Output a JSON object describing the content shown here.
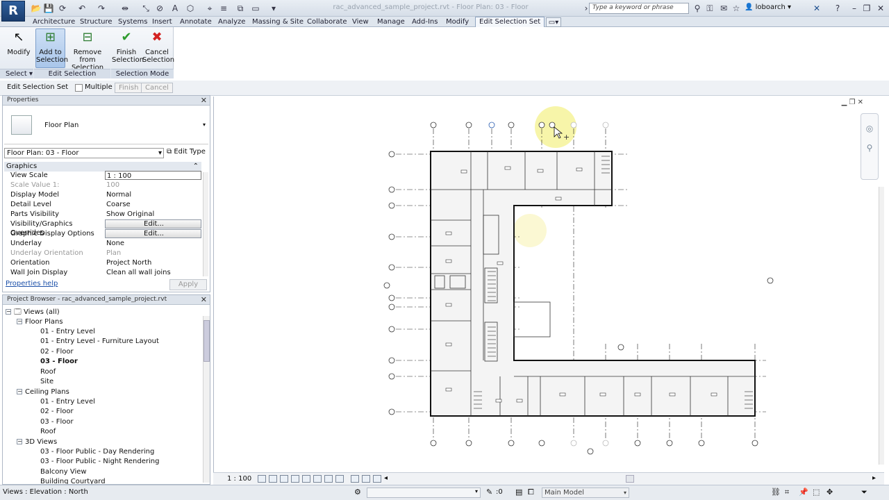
{
  "title_bar": {
    "window_title": "rac_advanced_sample_project.rvt - Floor Plan: 03 - Floor",
    "search_placeholder": "Type a keyword or phrase",
    "user": "loboarch",
    "app_letter": "R"
  },
  "ribbon_tabs": [
    "Architecture",
    "Structure",
    "Systems",
    "Insert",
    "Annotate",
    "Analyze",
    "Massing & Site",
    "Collaborate",
    "View",
    "Manage",
    "Add-Ins",
    "Modify",
    "Edit Selection Set"
  ],
  "ribbon": {
    "modify": "Modify",
    "add_line1": "Add to",
    "add_line2": "Selection",
    "remove_line1": "Remove from",
    "remove_line2": "Selection",
    "finish_line1": "Finish",
    "finish_line2": "Selection",
    "cancel_line1": "Cancel",
    "cancel_line2": "Selection",
    "group_select": "Select",
    "group_edit": "Edit Selection",
    "group_mode": "Selection Mode"
  },
  "options_bar": {
    "context": "Edit Selection Set",
    "multiple": "Multiple",
    "finish": "Finish",
    "cancel": "Cancel"
  },
  "properties": {
    "header": "Properties",
    "type_name": "Floor Plan",
    "instance": "Floor Plan: 03 - Floor",
    "edit_type": "Edit Type",
    "section": "Graphics",
    "rows": [
      {
        "k": "View Scale",
        "v": "1 : 100"
      },
      {
        "k": "Scale Value    1:",
        "v": "100"
      },
      {
        "k": "Display Model",
        "v": "Normal"
      },
      {
        "k": "Detail Level",
        "v": "Coarse"
      },
      {
        "k": "Parts Visibility",
        "v": "Show Original"
      },
      {
        "k": "Visibility/Graphics Overrides",
        "v": "Edit..."
      },
      {
        "k": "Graphic Display Options",
        "v": "Edit..."
      },
      {
        "k": "Underlay",
        "v": "None"
      },
      {
        "k": "Underlay Orientation",
        "v": "Plan"
      },
      {
        "k": "Orientation",
        "v": "Project North"
      },
      {
        "k": "Wall Join Display",
        "v": "Clean all wall joins"
      }
    ],
    "help": "Properties help",
    "apply": "Apply"
  },
  "browser": {
    "header": "Project Browser - rac_advanced_sample_project.rvt",
    "items": [
      {
        "t": "Views (all)"
      },
      {
        "t": "Floor Plans"
      },
      {
        "t": "01 - Entry Level"
      },
      {
        "t": "01 - Entry Level - Furniture Layout"
      },
      {
        "t": "02 - Floor"
      },
      {
        "t": "03 - Floor"
      },
      {
        "t": "Roof"
      },
      {
        "t": "Site"
      },
      {
        "t": "Ceiling Plans"
      },
      {
        "t": "01 - Entry Level"
      },
      {
        "t": "02 - Floor"
      },
      {
        "t": "03 - Floor"
      },
      {
        "t": "Roof"
      },
      {
        "t": "3D Views"
      },
      {
        "t": "03 - Floor Public - Day Rendering"
      },
      {
        "t": "03 - Floor Public - Night Rendering"
      },
      {
        "t": "Balcony View"
      },
      {
        "t": "Building Courtyard"
      }
    ]
  },
  "view_bar": {
    "scale": "1 : 100"
  },
  "status_bar": {
    "left_text": "Views : Elevation : North",
    "count": ":0",
    "model": "Main Model"
  }
}
